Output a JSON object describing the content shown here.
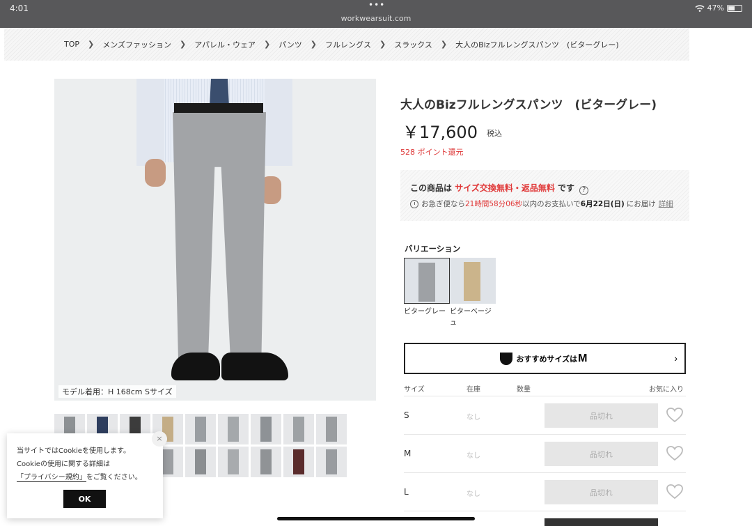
{
  "status": {
    "time": "4:01",
    "dots": "•••",
    "url": "workwearsuit.com",
    "battery": "47%"
  },
  "breadcrumb": [
    "TOP",
    "メンズファッション",
    "アパレル・ウェア",
    "パンツ",
    "フルレングス",
    "スラックス",
    "大人のBizフルレングスパンツ　(ビターグレー)"
  ],
  "gallery": {
    "model_caption": "モデル着用：H 168cm Sサイズ",
    "thumb_colors": [
      "#8d9194",
      "#2e3e5e",
      "#3c3c3c",
      "#c4ad86",
      "#9a9ea2",
      "#a4a8ab",
      "#8e9296",
      "#9ea2a5",
      "#9a9da0",
      "#a1a4a7",
      "#8f9396",
      "#a9acaf",
      "#9c9fa2",
      "#8b8e91",
      "#a8abae",
      "#909396",
      "#5a2c2c",
      "#999ca0"
    ]
  },
  "product": {
    "title": "大人のBizフルレングスパンツ　(ビターグレー)",
    "price": "￥17,600",
    "tax_label": "税込",
    "points": "528 ポイント還元"
  },
  "info": {
    "prefix": "この商品は",
    "highlight": "サイズ交換無料・返品無料",
    "suffix": "です",
    "help": "?",
    "delivery_prefix": "お急ぎ便なら",
    "countdown": "21時間58分06秒",
    "delivery_mid": "以内のお支払いで",
    "delivery_date": "6月22日(日)",
    "delivery_suffix": "にお届け",
    "detail_link": "詳細"
  },
  "variation": {
    "label": "バリエーション",
    "items": [
      {
        "name": "ビターグレー",
        "color": "#9ea1a5"
      },
      {
        "name": "ビターベージュ",
        "color": "#cbb48b"
      }
    ]
  },
  "recommend": {
    "text": "おすすめサイズは",
    "size": "M",
    "chevron": "›"
  },
  "size_table": {
    "headers": {
      "size": "サイズ",
      "stock": "在庫",
      "qty": "数量",
      "fav": "お気に入り"
    },
    "rows": [
      {
        "size": "S",
        "stock": "なし",
        "button": "品切れ"
      },
      {
        "size": "M",
        "stock": "なし",
        "button": "品切れ"
      },
      {
        "size": "L",
        "stock": "なし",
        "button": "品切れ"
      }
    ]
  },
  "cookie": {
    "line1": "当サイトではCookieを使用します。",
    "line2": "Cookieの使用に関する詳細は",
    "link_open": "「",
    "link": "プライバシー規約",
    "link_close": "」",
    "line3_rest": "をご覧ください。",
    "ok": "OK",
    "close": "×"
  }
}
